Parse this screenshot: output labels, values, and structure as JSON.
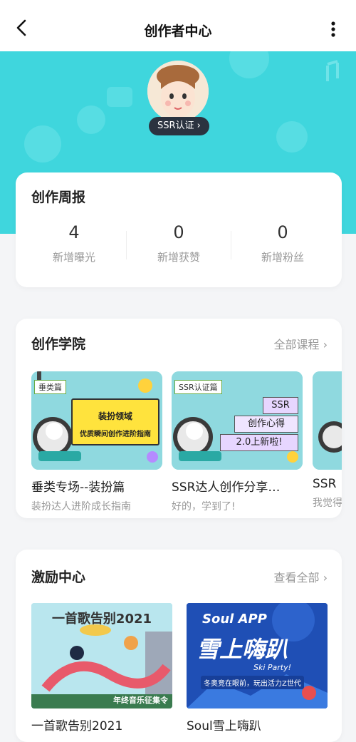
{
  "nav": {
    "title": "创作者中心",
    "back_icon": "chevron-left-icon",
    "more_icon": "more-vertical-icon"
  },
  "hero": {
    "background": "#3fd6dd",
    "badge": "SSR认证 ›"
  },
  "weekly": {
    "title": "创作周报",
    "stats": [
      {
        "value": "4",
        "label": "新增曝光"
      },
      {
        "value": "0",
        "label": "新增获赞"
      },
      {
        "value": "0",
        "label": "新增粉丝"
      }
    ]
  },
  "academy": {
    "title": "创作学院",
    "link": "全部课程 ›",
    "courses": [
      {
        "tag": "垂类篇",
        "banner": "装扮领域",
        "banner_sub": "优质瞬间创作进阶指南",
        "title": "垂类专场--装扮篇",
        "subtitle": "装扮达人进阶成长指南"
      },
      {
        "tag": "SSR认证篇",
        "banner": "SSR",
        "banner_sub": "创作心得",
        "banner_sub2": "2.0上新啦!",
        "title": "SSR达人创作分享…",
        "subtitle": "好的，学到了!"
      },
      {
        "title": "SSR",
        "subtitle": "我觉得"
      }
    ]
  },
  "incentive": {
    "title": "激励中心",
    "link": "查看全部 ›",
    "promos": [
      {
        "banner": "一首歌告别2021",
        "banner_sub": "年终音乐征集令",
        "title": "一首歌告别2021"
      },
      {
        "banner_top": "Soul APP",
        "banner": "雪上嗨趴",
        "banner_en": "Ski Party!",
        "banner_sub": "冬奥竞在眼前，玩出活力Z世代",
        "title": "Soul雪上嗨趴"
      }
    ]
  },
  "colors": {
    "accent": "#3fd6dd",
    "dark": "#2b3340"
  }
}
